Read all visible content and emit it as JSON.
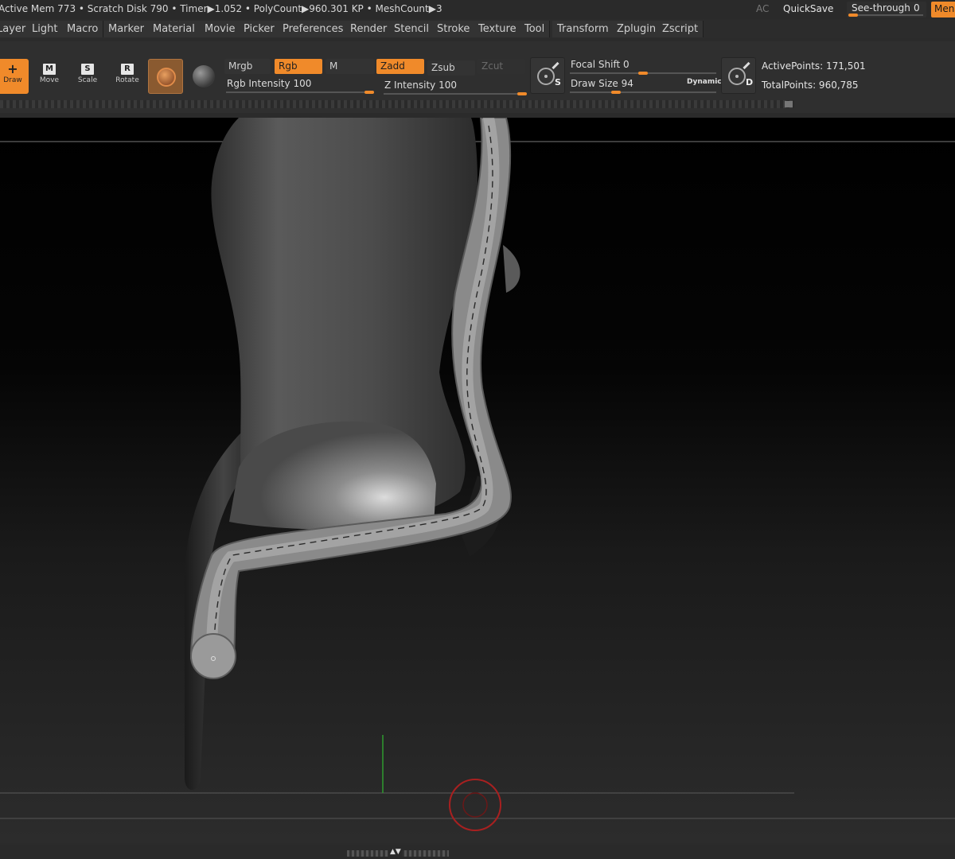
{
  "status_bar": {
    "text": "Active Mem 773 • Scratch Disk 790 •  Timer▶1.052 • PolyCount▶960.301 KP  • MeshCount▶3",
    "ac": "AC",
    "quicksave": "QuickSave",
    "see_through": {
      "label": "See-through",
      "value": "0",
      "level": 0
    },
    "menus": "Menus"
  },
  "menu_bar": {
    "items": [
      "Layer",
      "Light",
      "Macro",
      "Marker",
      "Material",
      "Movie",
      "Picker",
      "Preferences",
      "Render",
      "Stencil",
      "Stroke",
      "Texture",
      "Tool",
      "Transform",
      "Zplugin",
      "Zscript"
    ]
  },
  "shelf": {
    "tools": [
      {
        "label": "Draw",
        "glyph": "+",
        "active": true
      },
      {
        "label": "Move",
        "glyph": "M",
        "active": false
      },
      {
        "label": "Scale",
        "glyph": "S",
        "active": false
      },
      {
        "label": "Rotate",
        "glyph": "R",
        "active": false
      }
    ],
    "modes": {
      "mrgb": "Mrgb",
      "rgb": "Rgb",
      "m": "M",
      "zadd": "Zadd",
      "zsub": "Zsub",
      "zcut": "Zcut"
    },
    "rgb_intensity": {
      "label": "Rgb Intensity",
      "value": "100",
      "level": 1.0
    },
    "z_intensity": {
      "label": "Z Intensity",
      "value": "100",
      "level": 1.0
    },
    "focal_shift": {
      "label": "Focal Shift",
      "value": "0",
      "level": 0.5
    },
    "draw_size": {
      "label": "Draw Size",
      "value": "94",
      "level": 0.3
    },
    "lazy_s_letter": "S",
    "lazy_d_letter": "D",
    "dynamic": "Dynamic",
    "active_points": "ActivePoints: 171,501",
    "total_points": "TotalPoints: 960,785"
  },
  "colors": {
    "accent": "#f08a2a",
    "panel": "#2f2f2f",
    "menu_bg": "#333333"
  },
  "icons": [
    "draw-icon",
    "move-icon",
    "scale-icon",
    "rotate-icon",
    "material-sphere-icon",
    "stroke-sphere-icon",
    "lazy-mouse-s-icon",
    "lazy-mouse-d-icon"
  ]
}
